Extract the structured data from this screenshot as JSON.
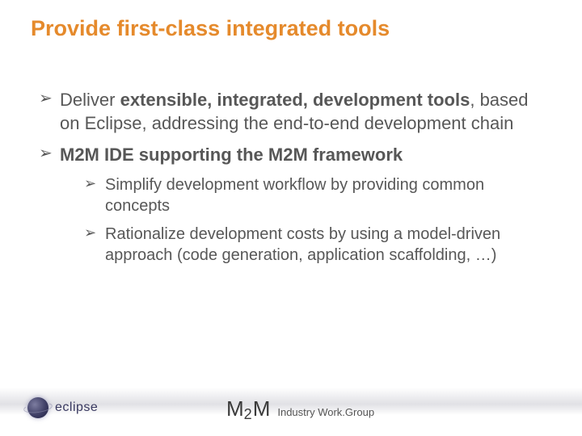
{
  "title": "Provide first-class integrated tools",
  "bullets": {
    "b1_pre": "Deliver ",
    "b1_bold": "extensible, integrated, development tools",
    "b1_post": ", based on Eclipse, addressing the end-to-end development chain",
    "b2": "M2M IDE supporting the M2M framework",
    "b2a": "Simplify development workflow by providing common concepts",
    "b2b": "Rationalize development costs by using a model-driven approach (code generation, application scaffolding, …)"
  },
  "footer": {
    "logo_text": "eclipse",
    "m2m_m1": "M",
    "m2m_2": "2",
    "m2m_m2": "M",
    "m2m_tag": "Industry Work.Group"
  }
}
